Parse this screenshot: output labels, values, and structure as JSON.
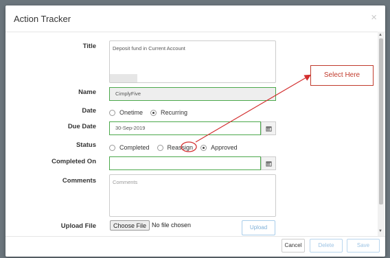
{
  "modal": {
    "title": "Action Tracker",
    "close_glyph": "×"
  },
  "form": {
    "title_label": "Title",
    "title_value": "Deposit fund in Current Account",
    "name_label": "Name",
    "name_value": "CimplyFive",
    "date_label": "Date",
    "date_options": [
      "Onetime",
      "Recurring"
    ],
    "date_selected": "Recurring",
    "due_date_label": "Due Date",
    "due_date_value": "30-Sep-2019",
    "status_label": "Status",
    "status_options": [
      "Completed",
      "Reassign",
      "Approved"
    ],
    "status_selected": "Approved",
    "completed_on_label": "Completed On",
    "completed_on_value": "",
    "comments_label": "Comments",
    "comments_placeholder": "Comments",
    "upload_label": "Upload File",
    "choose_file_label": "Choose File",
    "no_file_text": "No file chosen",
    "upload_button": "Upload"
  },
  "footer": {
    "cancel": "Cancel",
    "delete": "Delete",
    "save": "Save"
  },
  "annotation": {
    "callout_text": "Select Here",
    "color": "#c0392b"
  },
  "icons": {
    "calendar": "calendar-icon",
    "close": "close-icon"
  },
  "colors": {
    "valid_border": "#4aa84a",
    "primary_disabled": "#9cc3e4"
  }
}
